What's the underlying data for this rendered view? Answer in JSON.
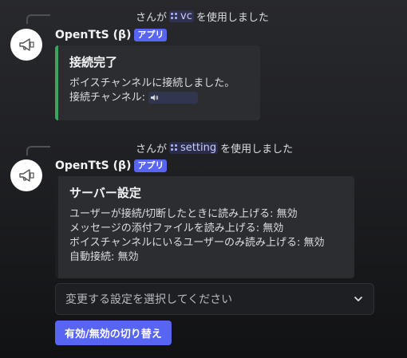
{
  "messages": [
    {
      "command_prefix": "さんが",
      "command_name": "vc",
      "command_suffix": "を使用しました",
      "username": "OpenTtS (β)",
      "app_tag": "アプリ",
      "embed": {
        "title": "接続完了",
        "lines": [
          "ボイスチャンネルに接続しました。",
          "接続チャンネル: "
        ],
        "accent": "#3ba55c"
      }
    },
    {
      "command_prefix": "さんが",
      "command_name": "setting",
      "command_suffix": "を使用しました",
      "username": "OpenTtS (β)",
      "app_tag": "アプリ",
      "embed": {
        "title": "サーバー設定",
        "lines": [
          "ユーザーが接続/切断したときに読み上げる: 無効",
          "メッセージの添付ファイルを読み上げる: 無効",
          "ボイスチャンネルにいるユーザーのみ読み上げる: 無効",
          "自動接続: 無効"
        ],
        "accent": "#1e1f22"
      },
      "select_menu": {
        "placeholder": "変更する設定を選択してください"
      },
      "button_label": "有効/無効の切り替え"
    }
  ],
  "icons": {
    "avatar": "megaphone-icon",
    "channel": "speaker-icon",
    "select": "chevron-down-icon"
  },
  "colors": {
    "brand": "#5865f2",
    "success": "#3ba55c"
  }
}
